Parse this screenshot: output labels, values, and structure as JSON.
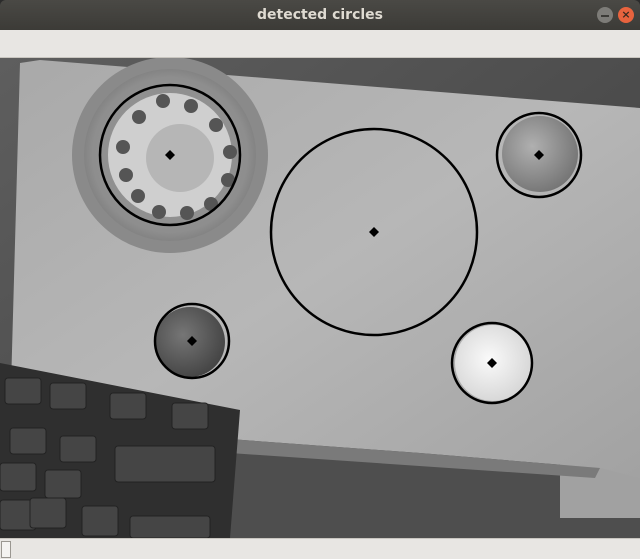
{
  "window": {
    "title": "detected circles",
    "minimize_icon": "minimize-icon",
    "close_icon": "close-icon",
    "close_glyph": "×"
  },
  "scene": {
    "description_icons": [
      "rotary-dial",
      "coin",
      "keyboard"
    ]
  },
  "detections": {
    "circle_color": "#000000",
    "center_marker": "diamond",
    "count": 5
  }
}
